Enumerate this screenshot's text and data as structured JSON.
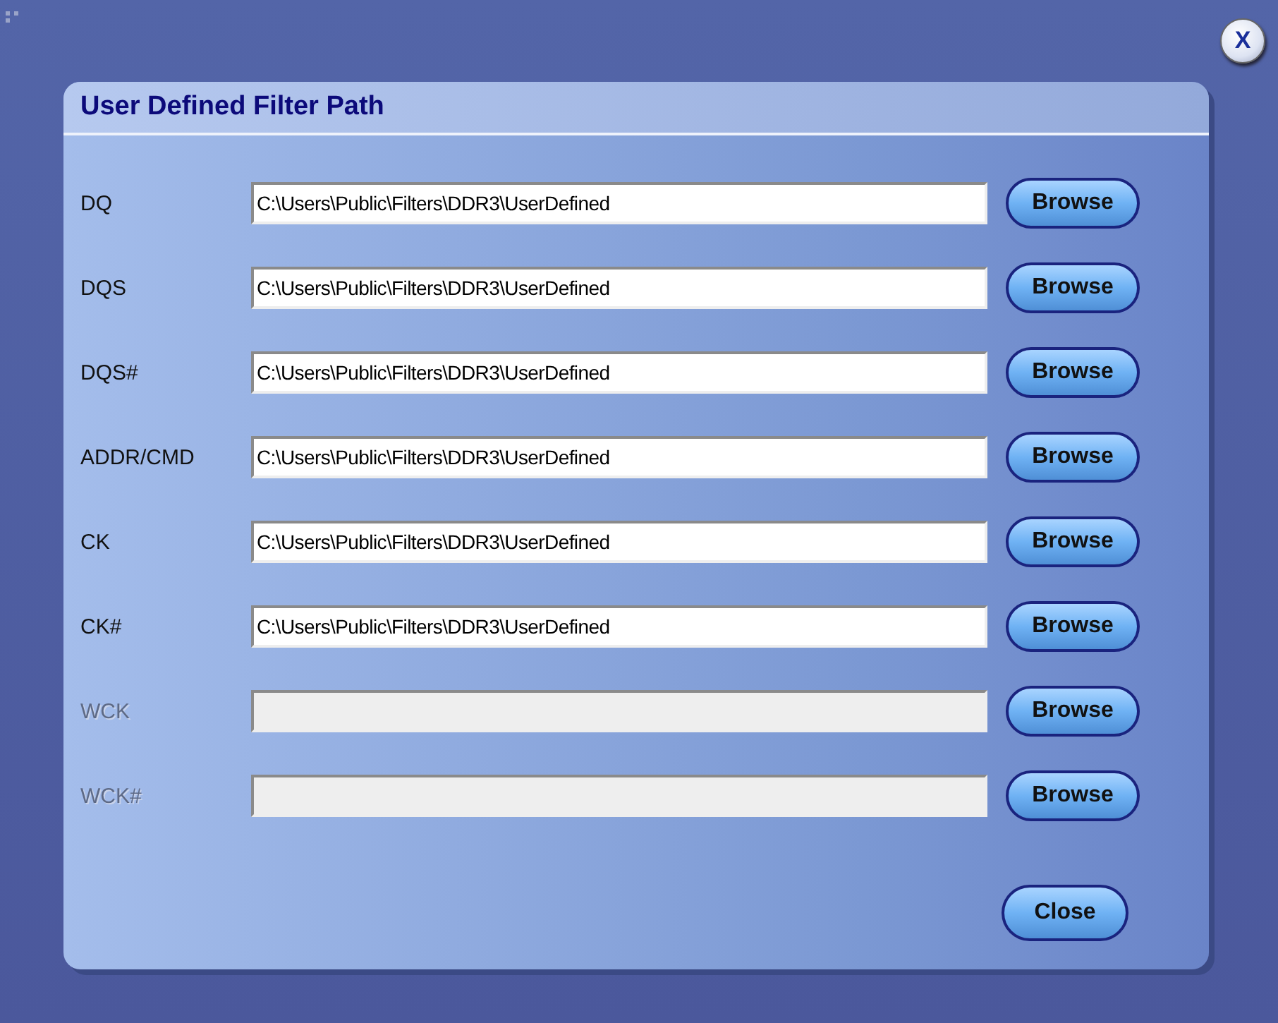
{
  "close_icon": "X",
  "dialog": {
    "title": "User Defined Filter Path",
    "rows": [
      {
        "label": "DQ",
        "value": "C:\\Users\\Public\\Filters\\DDR3\\UserDefined",
        "disabled": false,
        "button": "Browse"
      },
      {
        "label": "DQS",
        "value": "C:\\Users\\Public\\Filters\\DDR3\\UserDefined",
        "disabled": false,
        "button": "Browse"
      },
      {
        "label": "DQS#",
        "value": "C:\\Users\\Public\\Filters\\DDR3\\UserDefined",
        "disabled": false,
        "button": "Browse"
      },
      {
        "label": "ADDR/CMD",
        "value": "C:\\Users\\Public\\Filters\\DDR3\\UserDefined",
        "disabled": false,
        "button": "Browse"
      },
      {
        "label": "CK",
        "value": "C:\\Users\\Public\\Filters\\DDR3\\UserDefined",
        "disabled": false,
        "button": "Browse"
      },
      {
        "label": "CK#",
        "value": "C:\\Users\\Public\\Filters\\DDR3\\UserDefined",
        "disabled": false,
        "button": "Browse"
      },
      {
        "label": "WCK",
        "disabled": true,
        "button": "Browse"
      },
      {
        "label": "WCK#",
        "disabled": true,
        "button": "Browse"
      }
    ],
    "close_button": "Close"
  }
}
